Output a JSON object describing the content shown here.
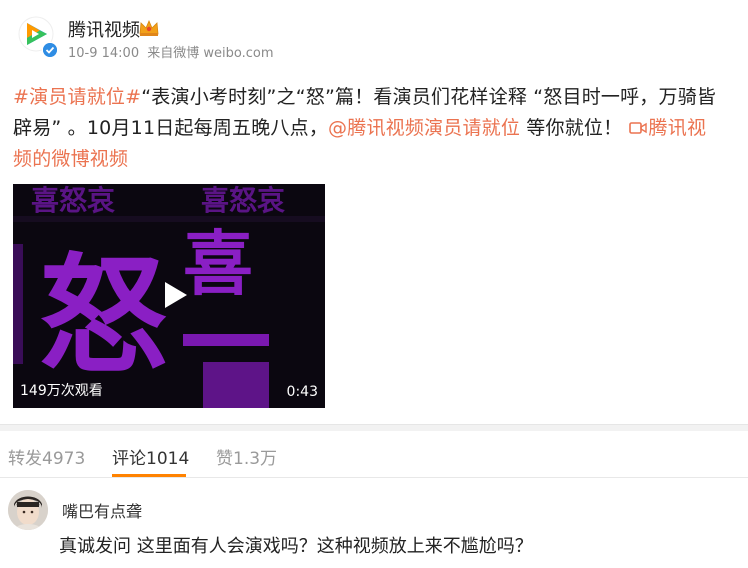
{
  "post": {
    "author": "腾讯视频",
    "author_logo_icon": "tencent-video-logo-icon",
    "vip_badge_icon": "crown-badge-icon",
    "time": "10-9 14:00",
    "source_prefix": "来自",
    "source": "微博 weibo.com",
    "text": {
      "hashtag": "#演员请就位#",
      "line1_rest": "“表演小考时刻”之“怒”篇！看演员们花样诠释 “怒目时一呼，万骑皆",
      "line2_start": "辟易” 。10月11日起每周五晚八点，",
      "mention": "@腾讯视频演员请就位",
      "line2_mid": " 等你就位！ ",
      "video_link_line2": "腾讯视",
      "video_link_line3": "频的微博视频"
    },
    "video": {
      "views": "149万次观看",
      "duration": "0:43",
      "art_chars": {
        "big_left": "怒",
        "big_right": "喜",
        "top_row": "喜怒哀",
        "top_row_right": "喜怒哀"
      }
    }
  },
  "tabs": [
    {
      "label": "转发4973",
      "active": false
    },
    {
      "label": "评论1014",
      "active": true
    },
    {
      "label": "赞1.3万",
      "active": false
    }
  ],
  "comment": {
    "user": "嘴巴有点聋",
    "text": "真诚发问 这里面有人会演戏吗？这种视频放上来不尴尬吗？"
  },
  "colors": {
    "link": "#eb7350",
    "active_tab_underline": "#ff8200",
    "video_purple": "#8a1fc4"
  }
}
